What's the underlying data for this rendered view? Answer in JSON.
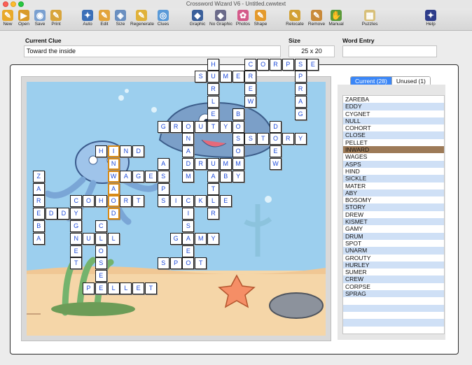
{
  "window": {
    "title": "Crossword Wizard V6 - Untitled.cwwtext"
  },
  "toolbar": [
    {
      "label": "New",
      "icon": "new-icon",
      "color": "#e9a92a",
      "glyph": "✎"
    },
    {
      "label": "Open",
      "icon": "open-icon",
      "color": "#d99b2a",
      "glyph": "▶"
    },
    {
      "label": "Save",
      "icon": "save-icon",
      "color": "#7aa0d0",
      "glyph": "◉"
    },
    {
      "label": "Print",
      "icon": "print-icon",
      "color": "#d8a53c",
      "glyph": "✎"
    },
    {
      "label": "Auto",
      "icon": "auto-icon",
      "color": "#3b6fb8",
      "glyph": "✦"
    },
    {
      "label": "Edit",
      "icon": "edit-icon",
      "color": "#e3a43c",
      "glyph": "✎"
    },
    {
      "label": "Size",
      "icon": "size-icon",
      "color": "#6a8fc0",
      "glyph": "◈"
    },
    {
      "label": "Regenerate",
      "icon": "regenerate-icon",
      "color": "#e0b23a",
      "glyph": "✎"
    },
    {
      "label": "Clues",
      "icon": "clues-icon",
      "color": "#5a9ad8",
      "glyph": "◎"
    },
    {
      "label": "Graphic",
      "icon": "graphic-icon",
      "color": "#3a5f9a",
      "glyph": "◆"
    },
    {
      "label": "No Graphic",
      "icon": "no-graphic-icon",
      "color": "#6b6b8a",
      "glyph": "◆"
    },
    {
      "label": "Photos",
      "icon": "photos-icon",
      "color": "#d45a8a",
      "glyph": "✿"
    },
    {
      "label": "Shape",
      "icon": "shape-icon",
      "color": "#e49a2c",
      "glyph": "✎"
    },
    {
      "label": "Relocate",
      "icon": "relocate-icon",
      "color": "#d2a033",
      "glyph": "✎"
    },
    {
      "label": "Remove",
      "icon": "remove-icon",
      "color": "#c98a3a",
      "glyph": "✎"
    },
    {
      "label": "Manual",
      "icon": "manual-icon",
      "color": "#5a9a3a",
      "glyph": "✋"
    },
    {
      "label": "Puzzles",
      "icon": "puzzles-icon",
      "color": "#d8c07a",
      "glyph": "▦"
    },
    {
      "label": "Help",
      "icon": "help-icon",
      "color": "#2d3c8a",
      "glyph": "✦"
    }
  ],
  "fields": {
    "current_clue_label": "Current Clue",
    "current_clue_value": "Toward the inside",
    "size_label": "Size",
    "size_value": "25 x 20",
    "word_entry_label": "Word Entry",
    "word_entry_value": ""
  },
  "tabs": {
    "current": "Current (28)",
    "unused": "Unused (1)"
  },
  "words": [
    "ZAREBA",
    "EDDY",
    "CYGNET",
    "NULL",
    "COHORT",
    "CLOSE",
    "PELLET",
    "INWARD",
    "WAGES",
    "ASPS",
    "HIND",
    "SICKLE",
    "MATER",
    "ABY",
    "BOSOMY",
    "STORY",
    "DREW",
    "KISMET",
    "GAMY",
    "DRUM",
    "SPOT",
    "UNARM",
    "GROUTY",
    "HURLEY",
    "SUMER",
    "CREW",
    "CORPSE",
    "SPRAG"
  ],
  "selected_word": "INWARD",
  "grid": {
    "letters": [
      [
        15,
        2,
        "H"
      ],
      [
        18,
        2,
        "C"
      ],
      [
        19,
        2,
        "O"
      ],
      [
        20,
        2,
        "R"
      ],
      [
        21,
        2,
        "P"
      ],
      [
        22,
        2,
        "S"
      ],
      [
        23,
        2,
        "E"
      ],
      [
        14,
        3,
        "S"
      ],
      [
        15,
        3,
        "U"
      ],
      [
        16,
        3,
        "M"
      ],
      [
        17,
        3,
        "E"
      ],
      [
        18,
        3,
        "R"
      ],
      [
        22,
        3,
        "P"
      ],
      [
        15,
        4,
        "R"
      ],
      [
        18,
        4,
        "E"
      ],
      [
        22,
        4,
        "R"
      ],
      [
        15,
        5,
        "L"
      ],
      [
        18,
        5,
        "W"
      ],
      [
        22,
        5,
        "A"
      ],
      [
        15,
        6,
        "E"
      ],
      [
        17,
        6,
        "B"
      ],
      [
        22,
        6,
        "G"
      ],
      [
        11,
        7,
        "G"
      ],
      [
        12,
        7,
        "R"
      ],
      [
        13,
        7,
        "O"
      ],
      [
        14,
        7,
        "U"
      ],
      [
        15,
        7,
        "T"
      ],
      [
        16,
        7,
        "Y"
      ],
      [
        17,
        7,
        "O"
      ],
      [
        20,
        7,
        "D"
      ],
      [
        13,
        8,
        "N"
      ],
      [
        17,
        8,
        "S"
      ],
      [
        18,
        8,
        "S"
      ],
      [
        19,
        8,
        "T"
      ],
      [
        20,
        8,
        "O"
      ],
      [
        21,
        8,
        "R"
      ],
      [
        22,
        8,
        "Y"
      ],
      [
        6,
        9,
        "H"
      ],
      [
        7,
        9,
        "I"
      ],
      [
        8,
        9,
        "N"
      ],
      [
        9,
        9,
        "D"
      ],
      [
        13,
        9,
        "A"
      ],
      [
        17,
        9,
        "O"
      ],
      [
        20,
        9,
        "E"
      ],
      [
        7,
        10,
        "N"
      ],
      [
        11,
        10,
        "A"
      ],
      [
        13,
        10,
        "D"
      ],
      [
        14,
        10,
        "R"
      ],
      [
        15,
        10,
        "U"
      ],
      [
        16,
        10,
        "M"
      ],
      [
        17,
        10,
        "M"
      ],
      [
        20,
        10,
        "W"
      ],
      [
        1,
        11,
        "Z"
      ],
      [
        7,
        11,
        "W"
      ],
      [
        8,
        11,
        "A"
      ],
      [
        9,
        11,
        "G"
      ],
      [
        10,
        11,
        "E"
      ],
      [
        11,
        11,
        "S"
      ],
      [
        13,
        11,
        "M"
      ],
      [
        15,
        11,
        "A"
      ],
      [
        16,
        11,
        "B"
      ],
      [
        17,
        11,
        "Y"
      ],
      [
        1,
        12,
        "A"
      ],
      [
        7,
        12,
        "A"
      ],
      [
        11,
        12,
        "P"
      ],
      [
        15,
        12,
        "T"
      ],
      [
        1,
        13,
        "R"
      ],
      [
        4,
        13,
        "C"
      ],
      [
        5,
        13,
        "O"
      ],
      [
        6,
        13,
        "H"
      ],
      [
        7,
        13,
        "O"
      ],
      [
        8,
        13,
        "R"
      ],
      [
        9,
        13,
        "T"
      ],
      [
        11,
        13,
        "S"
      ],
      [
        12,
        13,
        "I"
      ],
      [
        13,
        13,
        "C"
      ],
      [
        14,
        13,
        "K"
      ],
      [
        15,
        13,
        "L"
      ],
      [
        16,
        13,
        "E"
      ],
      [
        1,
        14,
        "E"
      ],
      [
        2,
        14,
        "D"
      ],
      [
        3,
        14,
        "D"
      ],
      [
        4,
        14,
        "Y"
      ],
      [
        7,
        14,
        "D"
      ],
      [
        13,
        14,
        "I"
      ],
      [
        15,
        14,
        "R"
      ],
      [
        1,
        15,
        "B"
      ],
      [
        4,
        15,
        "G"
      ],
      [
        6,
        15,
        "C"
      ],
      [
        13,
        15,
        "S"
      ],
      [
        1,
        16,
        "A"
      ],
      [
        4,
        16,
        "N"
      ],
      [
        5,
        16,
        "U"
      ],
      [
        6,
        16,
        "L"
      ],
      [
        7,
        16,
        "L"
      ],
      [
        12,
        16,
        "G"
      ],
      [
        13,
        16,
        "A"
      ],
      [
        14,
        16,
        "M"
      ],
      [
        15,
        16,
        "Y"
      ],
      [
        4,
        17,
        "E"
      ],
      [
        6,
        17,
        "O"
      ],
      [
        13,
        17,
        "E"
      ],
      [
        4,
        18,
        "T"
      ],
      [
        6,
        18,
        "S"
      ],
      [
        11,
        18,
        "S"
      ],
      [
        12,
        18,
        "P"
      ],
      [
        13,
        18,
        "O"
      ],
      [
        14,
        18,
        "T"
      ],
      [
        6,
        19,
        "E"
      ],
      [
        5,
        20,
        "P"
      ],
      [
        6,
        20,
        "E"
      ],
      [
        7,
        20,
        "L"
      ],
      [
        8,
        20,
        "L"
      ],
      [
        9,
        20,
        "E"
      ],
      [
        10,
        20,
        "T"
      ]
    ],
    "selected_cells": [
      [
        7,
        9
      ],
      [
        7,
        10
      ],
      [
        7,
        11
      ],
      [
        7,
        12
      ],
      [
        7,
        13
      ],
      [
        7,
        14
      ]
    ]
  }
}
